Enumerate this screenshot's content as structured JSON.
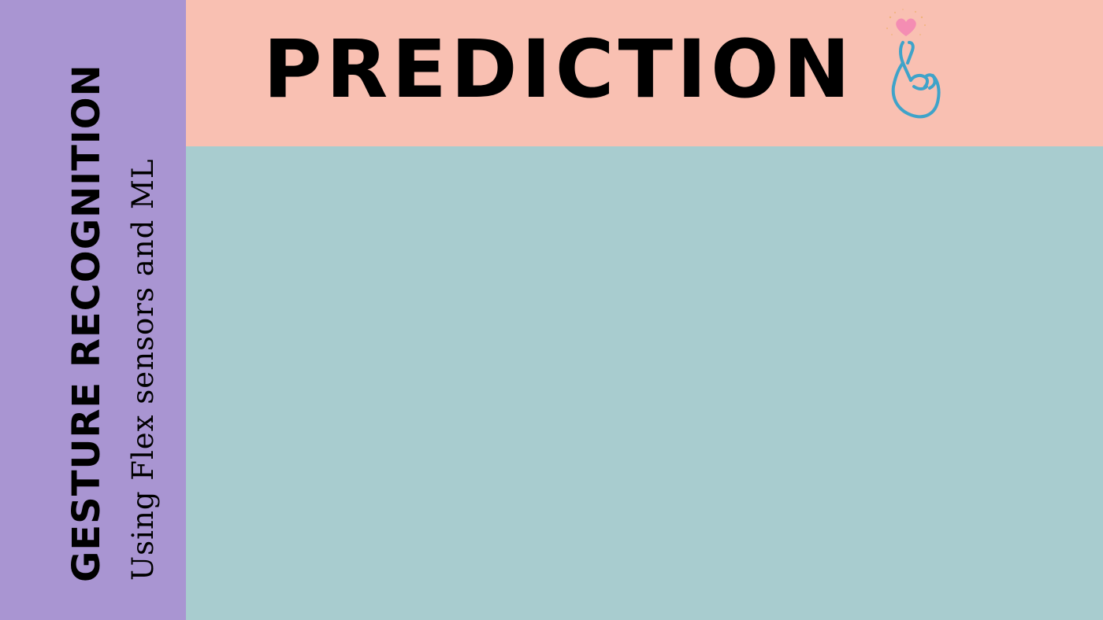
{
  "sidebar": {
    "title": "GESTURE RECOGNITION",
    "subtitle": "Using Flex sensors and ML",
    "background": "#a995d2"
  },
  "header": {
    "title": "PREDICTION",
    "background": "#f9c0b2",
    "icon": "finger-heart-icon"
  },
  "main": {
    "background": "#a8cccf"
  }
}
